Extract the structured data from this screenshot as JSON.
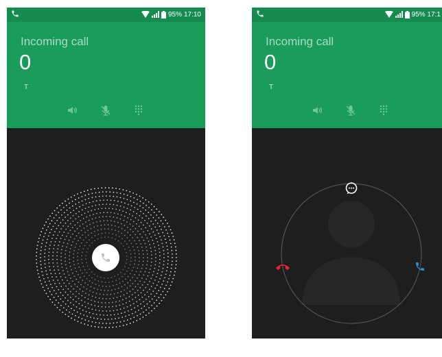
{
  "left_screen": {
    "status": {
      "battery": "95%",
      "time": "17:10",
      "icons": [
        "phone-icon",
        "wifi-icon",
        "signal-icon",
        "battery-icon"
      ]
    },
    "call": {
      "state": "Incoming call",
      "name": "0",
      "sub": "T"
    },
    "controls": [
      "speaker-icon",
      "mute-icon",
      "dialpad-icon"
    ],
    "answer_icon": "phone-handset-icon"
  },
  "right_screen": {
    "status": {
      "battery": "95%",
      "time": "17:1",
      "icons": [
        "phone-icon",
        "wifi-icon",
        "signal-icon",
        "battery-icon"
      ]
    },
    "call": {
      "state": "Incoming call",
      "name": "0",
      "sub": "T"
    },
    "controls": [
      "speaker-icon",
      "mute-icon",
      "dialpad-icon"
    ],
    "targets": [
      "message-icon",
      "decline-icon",
      "answer-icon"
    ]
  },
  "colors": {
    "header": "#1a9d5b",
    "statusbar": "#168b50",
    "body": "#1e1e1e",
    "decline": "#e8263a",
    "answer": "#2a8fd8"
  }
}
